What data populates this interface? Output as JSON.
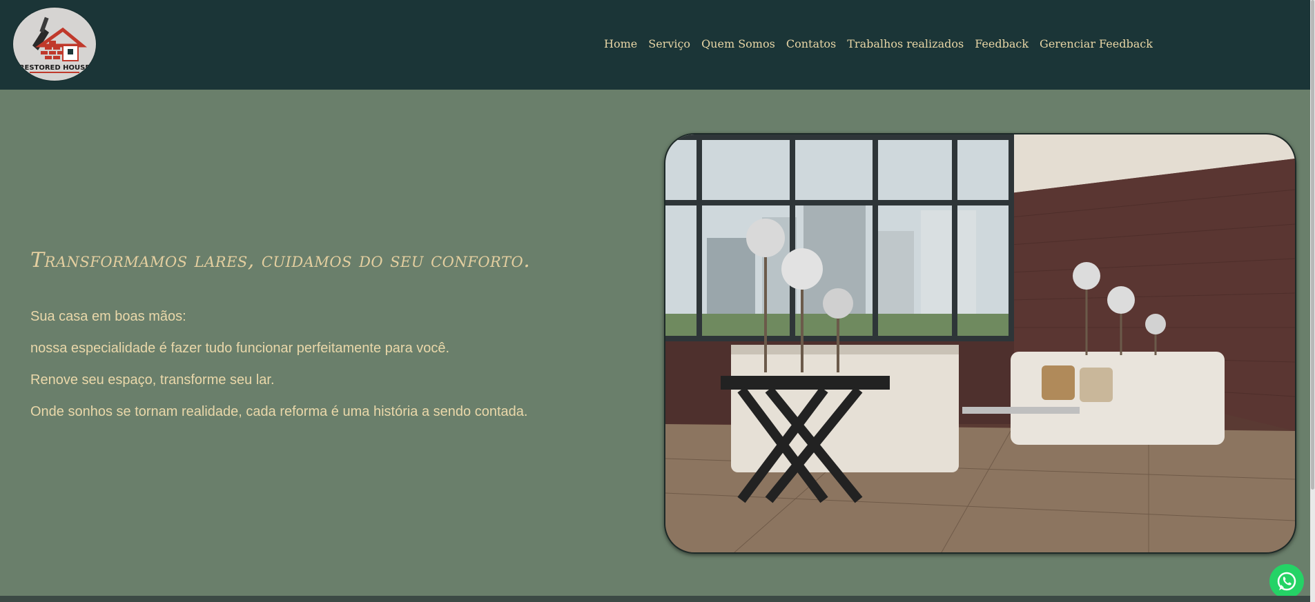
{
  "brand": {
    "logo_text": "RESTORED HOUSE",
    "logo_icon": "house-trowel-logo"
  },
  "nav": {
    "items": [
      {
        "label": "Home"
      },
      {
        "label": "Serviço"
      },
      {
        "label": "Quem Somos"
      },
      {
        "label": "Contatos"
      },
      {
        "label": "Trabalhos realizados"
      },
      {
        "label": "Feedback"
      },
      {
        "label": "Gerenciar Feedback"
      }
    ]
  },
  "hero": {
    "title": "Transformamos lares, cuidamos do seu conforto.",
    "paragraphs": [
      "Sua casa em boas mãos:",
      "nossa especialidade é fazer tudo funcionar perfeitamente para você.",
      "Renove seu espaço, transforme seu lar.",
      "Onde sonhos se tornam realidade, cada reforma é uma história a sendo contada."
    ],
    "image_icon": "living-room-photo"
  },
  "floating": {
    "whatsapp_icon": "whatsapp-icon"
  },
  "colors": {
    "header_bg": "#1b3537",
    "page_bg": "#6a7f6b",
    "accent_text": "#e8d6a6",
    "whatsapp": "#25d366"
  }
}
